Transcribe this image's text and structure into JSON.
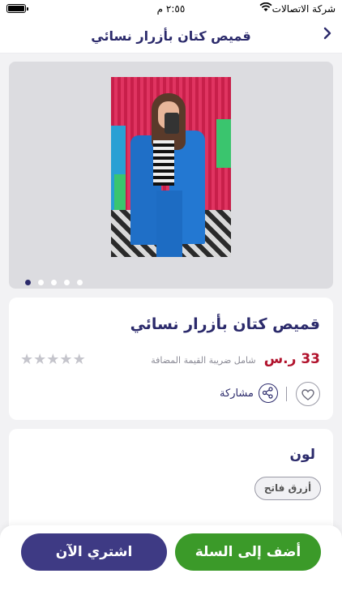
{
  "status_bar": {
    "carrier": "شركة الاتصالات",
    "time": "٢:٥٥ م"
  },
  "header": {
    "title": "قميص كتان بأزرار نسائي",
    "back_icon": "chevron-right-icon"
  },
  "gallery": {
    "image_alt": "product-photo",
    "page_count": 5,
    "active_page": 1
  },
  "product": {
    "title": "قميص كتان بأزرار نسائي",
    "price": "33 ر.س",
    "vat_note": "شامل ضريبة القيمة المضافة",
    "rating": 0,
    "rating_max": 5,
    "share_label": "مشاركة",
    "favorite_icon": "heart-icon",
    "share_icon": "share-icon"
  },
  "options": {
    "color_label": "لون",
    "color_value": "أزرق فاتح"
  },
  "footer": {
    "add_to_cart": "أضف إلى السلة",
    "buy_now": "اشتري الآن"
  },
  "colors": {
    "primary": "#3e3a84",
    "cart": "#3b9a29",
    "price": "#b1122c"
  }
}
